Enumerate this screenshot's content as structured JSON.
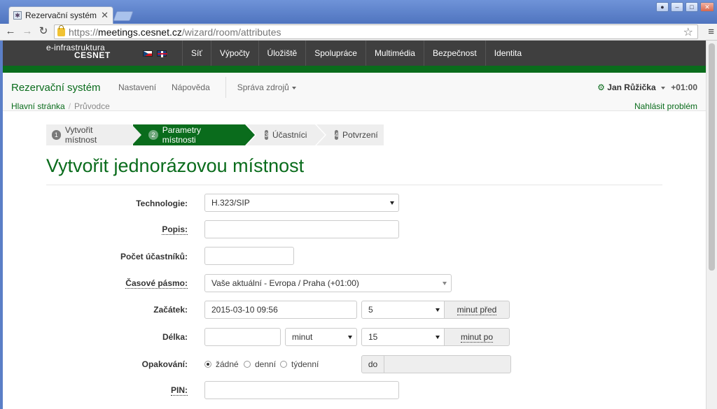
{
  "browser": {
    "tab_title": "Rezervační systém - Průvodce",
    "url_protocol": "https://",
    "url_host": "meetings.cesnet.cz",
    "url_path": "/wizard/room/attributes"
  },
  "topbar": {
    "logo_line1": "e-infrastruktura",
    "logo_line2": "CESNET",
    "nav": [
      "Síť",
      "Výpočty",
      "Úložiště",
      "Spolupráce",
      "Multimédia",
      "Bezpečnost",
      "Identita"
    ]
  },
  "app": {
    "brand": "Rezervační systém",
    "nav_settings": "Nastavení",
    "nav_help": "Nápověda",
    "nav_resources": "Správa zdrojů",
    "user": "Jan Růžička",
    "timezone": "+01:00",
    "breadcrumb_home": "Hlavní stránka",
    "breadcrumb_separator": "/",
    "breadcrumb_current": "Průvodce",
    "report_problem": "Nahlásit problém"
  },
  "wizard": {
    "steps": [
      {
        "num": "1",
        "label": "Vytvořit místnost"
      },
      {
        "num": "2",
        "label": "Parametry místnosti"
      },
      {
        "num": "3",
        "label": "Účastníci"
      },
      {
        "num": "4",
        "label": "Potvrzení"
      }
    ]
  },
  "page": {
    "title": "Vytvořit jednorázovou místnost"
  },
  "form": {
    "technology_label": "Technologie:",
    "technology_value": "H.323/SIP",
    "description_label": "Popis:",
    "description_value": "",
    "participants_label": "Počet účastníků:",
    "participants_value": "",
    "timezone_label": "Časové pásmo:",
    "timezone_value": "Vaše aktuální - Evropa / Praha (+01:00)",
    "start_label": "Začátek:",
    "start_value": "2015-03-10 09:56",
    "start_before_value": "5",
    "start_before_addon": "minut před",
    "duration_label": "Délka:",
    "duration_value": "",
    "duration_unit": "minut",
    "duration_after_value": "15",
    "duration_after_addon": "minut po",
    "repeat_label": "Opakování:",
    "repeat_options": [
      "žádné",
      "denní",
      "týdenní"
    ],
    "repeat_selected": "žádné",
    "repeat_until_addon": "do",
    "repeat_until_value": "",
    "pin_label": "PIN:",
    "pin_value": ""
  }
}
